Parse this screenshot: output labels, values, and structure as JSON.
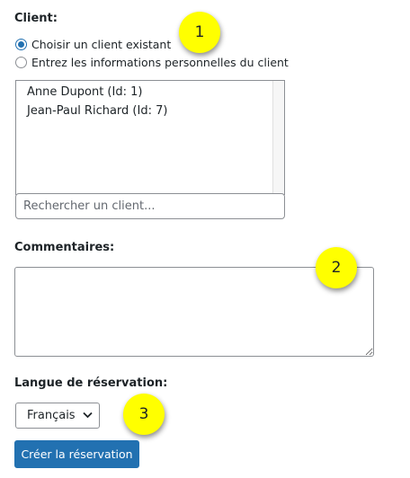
{
  "client": {
    "label": "Client:",
    "radio_existing": "Choisir un client existant",
    "radio_new": "Entrez les informations personnelles du client",
    "selected_option": "existing",
    "list": [
      "Anne Dupont (Id: 1)",
      "Jean-Paul Richard (Id: 7)"
    ],
    "search_placeholder": "Rechercher un client..."
  },
  "comments": {
    "label": "Commentaires:",
    "value": ""
  },
  "language": {
    "label": "Langue de réservation:",
    "selected": "Français"
  },
  "submit_label": "Créer la réservation",
  "callouts": [
    "1",
    "2",
    "3"
  ],
  "colors": {
    "accent": "#2271b1",
    "callout": "#ffff00",
    "text": "#1d2327",
    "border": "#8c8f94"
  }
}
